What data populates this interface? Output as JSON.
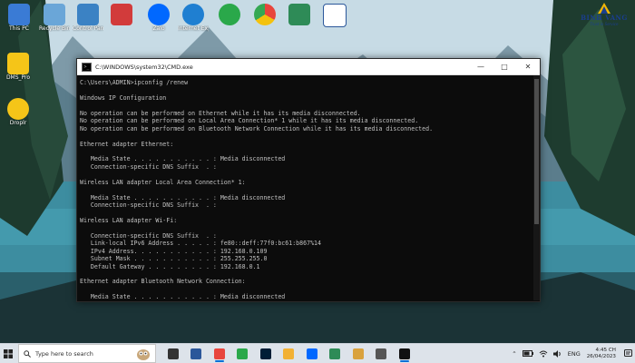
{
  "window": {
    "title": "C:\\WINDOWS\\system32\\CMD.exe",
    "icon": "cmd-icon",
    "controls": [
      "minimize-icon",
      "maximize-icon",
      "close-icon"
    ],
    "minimize_glyph": "—",
    "maximize_glyph": "□",
    "close_glyph": "✕"
  },
  "console": {
    "lines": [
      "C:\\Users\\ADMIN>ipconfig /renew",
      "",
      "Windows IP Configuration",
      "",
      "No operation can be performed on Ethernet while it has its media disconnected.",
      "No operation can be performed on Local Area Connection* 1 while it has its media disconnected.",
      "No operation can be performed on Bluetooth Network Connection while it has its media disconnected.",
      "",
      "Ethernet adapter Ethernet:",
      "",
      "   Media State . . . . . . . . . . . : Media disconnected",
      "   Connection-specific DNS Suffix  . :",
      "",
      "Wireless LAN adapter Local Area Connection* 1:",
      "",
      "   Media State . . . . . . . . . . . : Media disconnected",
      "   Connection-specific DNS Suffix  . :",
      "",
      "Wireless LAN adapter Wi-Fi:",
      "",
      "   Connection-specific DNS Suffix  . :",
      "   Link-local IPv6 Address . . . . . : fe80::deff:77f0:bc61:b867%14",
      "   IPv4 Address. . . . . . . . . . . : 192.168.0.109",
      "   Subnet Mask . . . . . . . . . . . : 255.255.255.0",
      "   Default Gateway . . . . . . . . . : 192.168.0.1",
      "",
      "Ethernet adapter Bluetooth Network Connection:",
      "",
      "   Media State . . . . . . . . . . . : Media disconnected"
    ]
  },
  "desktop": {
    "icons": [
      {
        "label": "This PC",
        "icon": "this-pc-icon",
        "color": "#3a7bd5"
      },
      {
        "label": "Recycle Bin",
        "icon": "recycle-bin-icon",
        "color": "#6aa6d8"
      },
      {
        "label": "Control Panel",
        "icon": "control-panel-icon",
        "color": "#d23b3b"
      },
      {
        "label": "Zalo",
        "icon": "zalo-icon",
        "color": "#0068ff"
      },
      {
        "label": "Internet Explorer",
        "icon": "internet-explorer-icon",
        "color": "#1f7fd1"
      },
      {
        "label": "CCleaner",
        "icon": "ccleaner-icon",
        "color": "#2aa84a"
      },
      {
        "label": "Google Chrome",
        "icon": "chrome-icon",
        "color": "#e8453c"
      },
      {
        "label": "Camtasia",
        "icon": "camtasia-icon",
        "color": "#2e8b57"
      },
      {
        "label": "Word",
        "icon": "word-icon",
        "color": "#2b579a"
      }
    ],
    "side_icons": [
      {
        "label": "DMS_Pro",
        "icon": "dms-icon",
        "color": "#f5c518"
      },
      {
        "label": "Droplr",
        "icon": "droplr-icon",
        "color": "#f5c518"
      }
    ]
  },
  "brand": {
    "name": "BINH VANG",
    "tagline": "Trust in Service",
    "icon": "binh-vang-logo-icon"
  },
  "taskbar": {
    "start_icon": "windows-start-icon",
    "search_placeholder": "Type here to search",
    "search_icon": "search-icon",
    "apps": [
      {
        "icon": "task-view-icon",
        "color": "#333333",
        "active": false
      },
      {
        "icon": "word-icon",
        "color": "#2b579a",
        "active": false
      },
      {
        "icon": "chrome-icon",
        "color": "#e8453c",
        "active": true
      },
      {
        "icon": "ccleaner-icon",
        "color": "#2aa84a",
        "active": false
      },
      {
        "icon": "photoshop-icon",
        "color": "#001e36",
        "active": false
      },
      {
        "icon": "file-explorer-icon",
        "color": "#f2b134",
        "active": false
      },
      {
        "icon": "zalo-icon",
        "color": "#0068ff",
        "active": false
      },
      {
        "icon": "camtasia-icon",
        "color": "#2e8b57",
        "active": false
      },
      {
        "icon": "paint-icon",
        "color": "#d9a23d",
        "active": false
      },
      {
        "icon": "settings-icon",
        "color": "#555555",
        "active": false
      },
      {
        "icon": "cmd-icon",
        "color": "#111111",
        "active": true
      }
    ],
    "tray": {
      "chevron_icon": "chevron-up-icon",
      "chevron_glyph": "⌃",
      "battery_icon": "battery-icon",
      "wifi_icon": "wifi-icon",
      "volume_icon": "volume-icon",
      "language": "ENG",
      "time": "4:45 CH",
      "date": "26/04/2023",
      "notification_icon": "notification-icon"
    }
  }
}
